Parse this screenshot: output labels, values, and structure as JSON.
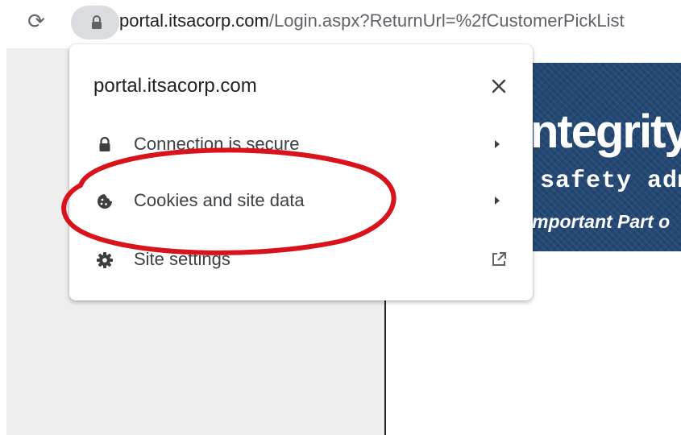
{
  "browser": {
    "url_domain": "portal.itsacorp.com",
    "url_path": "/Login.aspx?ReturnUrl=%2fCustomerPickList",
    "reload_icon": "reload-icon",
    "lock_icon": "lock-icon"
  },
  "site_info_popup": {
    "title": "portal.itsacorp.com",
    "close_icon": "close-icon",
    "items": [
      {
        "label": "Connection is secure",
        "icon": "lock-icon",
        "trailing": "chevron-right-icon"
      },
      {
        "label": "Cookies and site data",
        "icon": "cookie-icon",
        "trailing": "chevron-right-icon"
      },
      {
        "label": "Site settings",
        "icon": "gear-icon",
        "trailing": "external-link-icon"
      }
    ]
  },
  "banner": {
    "line1": "ntegrity",
    "line2": "safety adm",
    "line3": "mportant Part o"
  },
  "annotation": {
    "shape": "ellipse",
    "color": "#d9131b",
    "target": "Cookies and site data"
  },
  "colors": {
    "chip_bg": "#dadce0",
    "banner_bg": "#234873",
    "icon_gray": "#5f6368"
  }
}
